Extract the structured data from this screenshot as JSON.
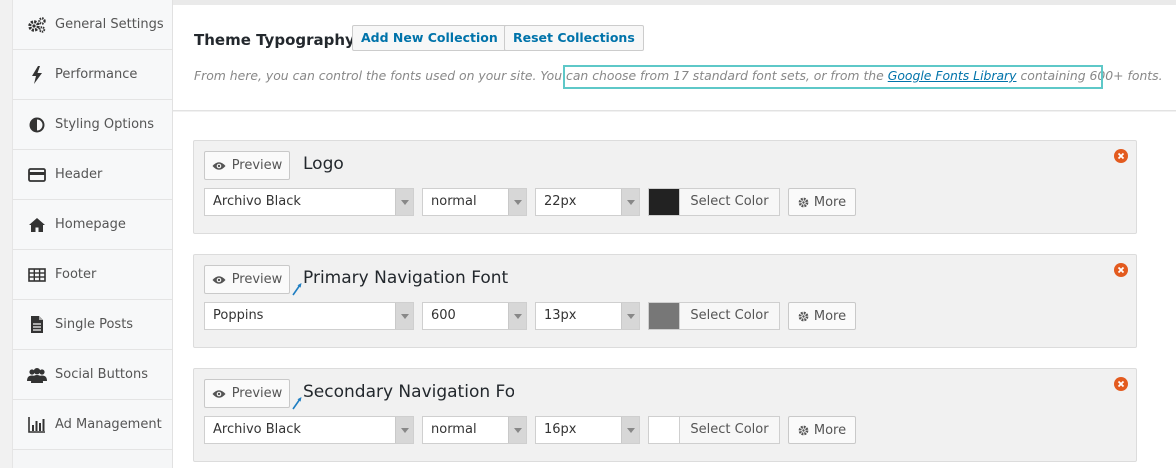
{
  "sidebar": {
    "items": [
      {
        "label": "General Settings",
        "icon": "gears-icon"
      },
      {
        "label": "Performance",
        "icon": "bolt-icon"
      },
      {
        "label": "Styling Options",
        "icon": "contrast-icon"
      },
      {
        "label": "Header",
        "icon": "credit-card-icon"
      },
      {
        "label": "Homepage",
        "icon": "home-icon"
      },
      {
        "label": "Footer",
        "icon": "table-icon"
      },
      {
        "label": "Single Posts",
        "icon": "document-icon"
      },
      {
        "label": "Social Buttons",
        "icon": "users-icon"
      },
      {
        "label": "Ad Management",
        "icon": "bar-chart-icon"
      }
    ]
  },
  "header": {
    "title": "Theme Typography",
    "add_label": "Add New Collection",
    "reset_label": "Reset Collections",
    "desc_prefix": "From here, you can control the fonts used on your site. You can choose from 17 standard font sets, or from the ",
    "desc_link": "Google Fonts Library",
    "desc_suffix": " containing 600+ fonts."
  },
  "fonts": [
    {
      "name": "Logo",
      "preview_label": "Preview",
      "family": "Archivo Black",
      "weight": "normal",
      "size": "22px",
      "color": "#222222",
      "color_label": "Select Color",
      "more_label": "More"
    },
    {
      "name": "Primary Navigation Font",
      "preview_label": "Preview",
      "family": "Poppins",
      "weight": "600",
      "size": "13px",
      "color": "#777777",
      "color_label": "Select Color",
      "more_label": "More"
    },
    {
      "name": "Secondary Navigation Fon",
      "preview_label": "Preview",
      "family": "Archivo Black",
      "weight": "normal",
      "size": "16px",
      "color": "#ffffff",
      "color_label": "Select Color",
      "more_label": "More"
    }
  ],
  "colors": {
    "link": "#0073aa",
    "close": "#e35b1f",
    "highlight": "#5ec8c8"
  }
}
